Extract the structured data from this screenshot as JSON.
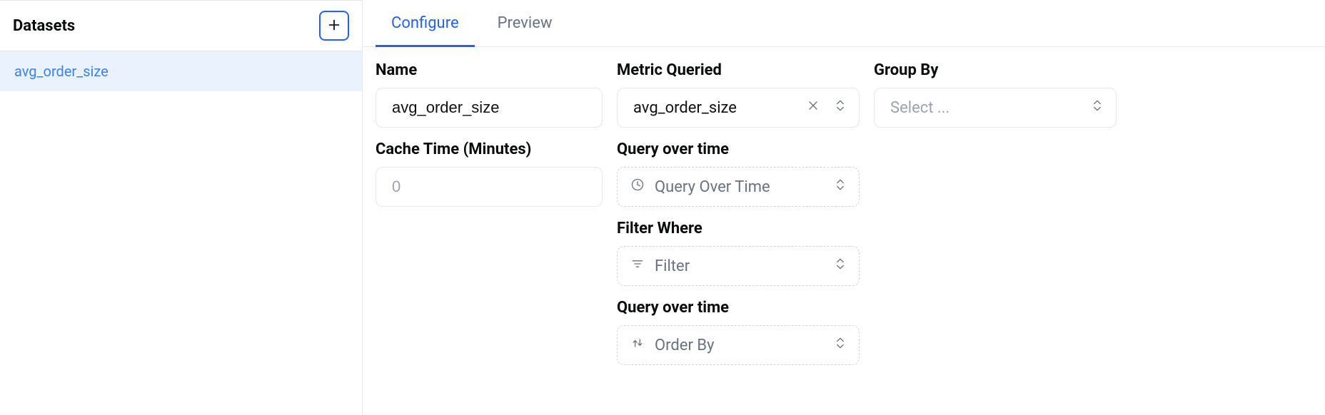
{
  "sidebar": {
    "title": "Datasets",
    "add_button_label": "+",
    "items": [
      {
        "label": "avg_order_size",
        "selected": true
      }
    ]
  },
  "tabs": [
    {
      "label": "Configure",
      "active": true
    },
    {
      "label": "Preview",
      "active": false
    }
  ],
  "form": {
    "name": {
      "label": "Name",
      "value": "avg_order_size"
    },
    "metric_queried": {
      "label": "Metric Queried",
      "value": "avg_order_size"
    },
    "group_by": {
      "label": "Group By",
      "placeholder": "Select ..."
    },
    "cache_time": {
      "label": "Cache Time (Minutes)",
      "placeholder": "0",
      "value": ""
    },
    "query_over_time_1": {
      "label": "Query over time",
      "placeholder": "Query Over Time"
    },
    "filter_where": {
      "label": "Filter Where",
      "placeholder": "Filter"
    },
    "query_over_time_2": {
      "label": "Query over time",
      "placeholder": "Order By"
    }
  },
  "icons": {
    "plus": "plus-icon",
    "clear": "x-icon",
    "chevrons": "chevrons-up-down-icon",
    "clock": "clock-icon",
    "filter": "filter-icon",
    "sort": "sort-icon"
  }
}
